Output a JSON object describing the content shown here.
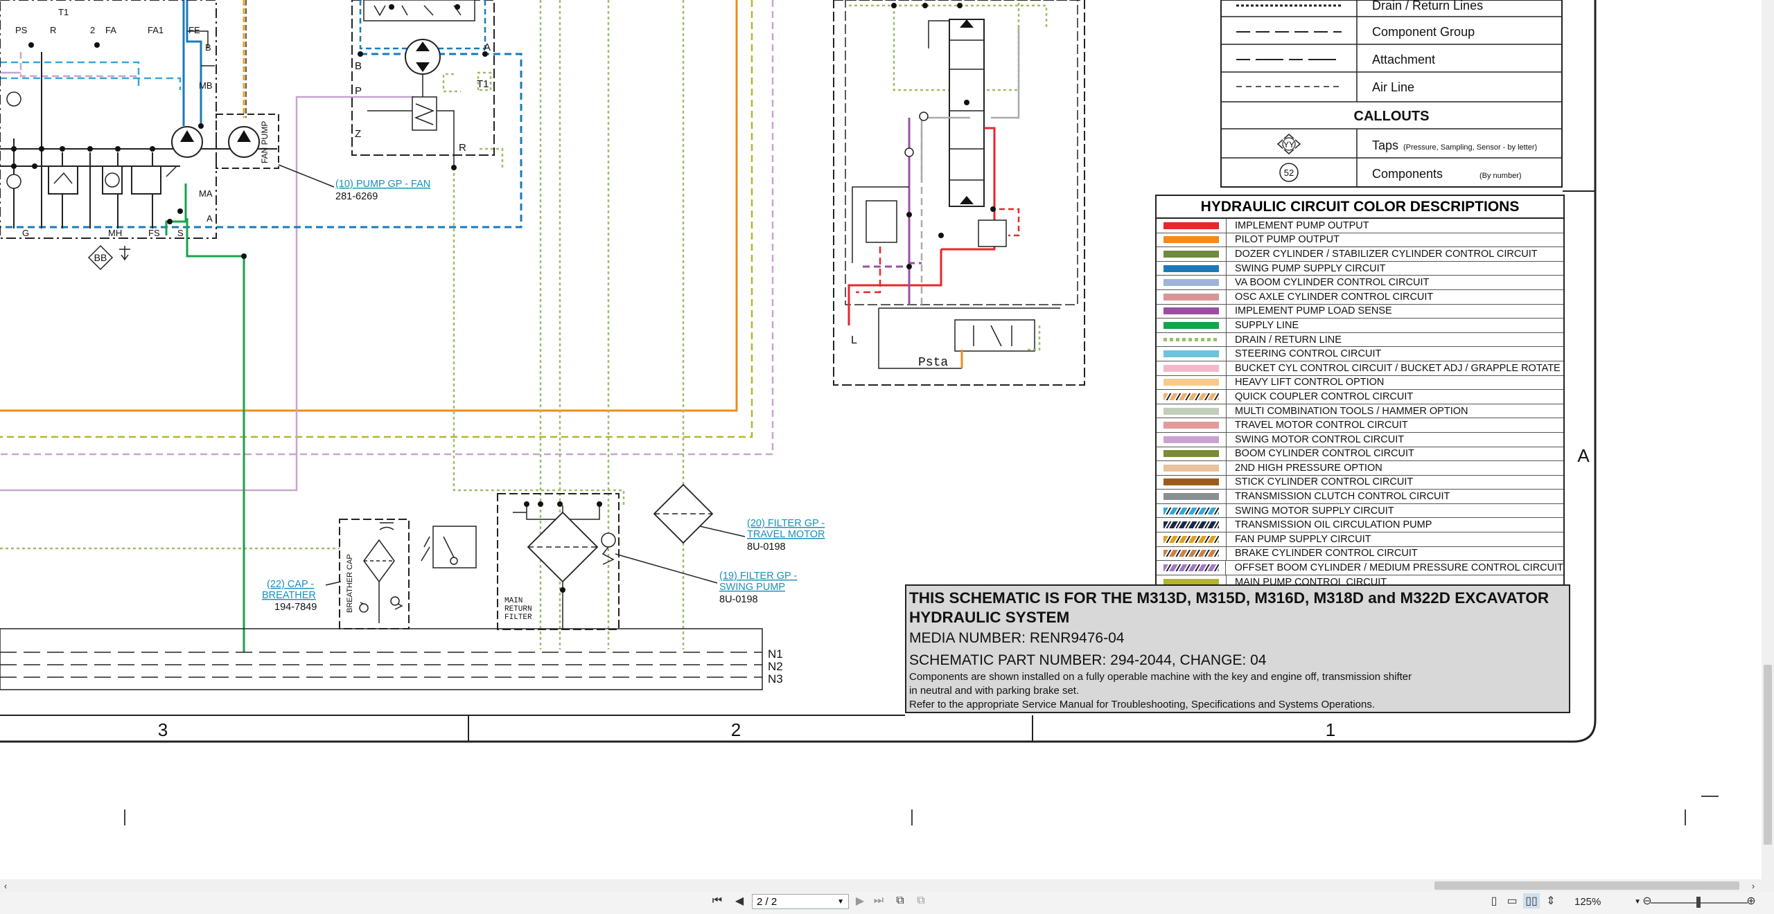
{
  "diagram": {
    "ports_left": [
      "PS",
      "R",
      "T1",
      "2",
      "FA",
      "FA1",
      "FE",
      "B",
      "MB",
      "MA",
      "A",
      "G",
      "MH",
      "FS",
      "S"
    ],
    "ports_mid": [
      "B",
      "P",
      "Z",
      "R",
      "T1",
      "A"
    ],
    "fan_pump_label": "FAN PUMP",
    "tap_bb": "BB",
    "callout_pump_fan": {
      "link": "(10) PUMP GP - FAN",
      "part": "281-6269"
    },
    "callout_cap_breather": {
      "link1": "(22) CAP -",
      "link2": "BREATHER",
      "part": "194-7849"
    },
    "breather_cap_label": "BREATHER CAP",
    "main_return_filter_label": [
      "MAIN",
      "RETURN",
      "FILTER"
    ],
    "callout_filter_travel": {
      "link1": "(20) FILTER GP -",
      "link2": "TRAVEL MOTOR",
      "part": "8U-0198"
    },
    "callout_filter_swing": {
      "link1": "(19) FILTER GP -",
      "link2": "SWING PUMP",
      "part": "8U-0198"
    },
    "valve_labels": [
      "L",
      "Psta"
    ],
    "tank_lines": [
      "N1",
      "N2",
      "N3"
    ],
    "zones": [
      "3",
      "2",
      "1"
    ],
    "row_marker": "A"
  },
  "line_key": {
    "rows": [
      {
        "label": "Drain / Return Lines",
        "style": "dotted"
      },
      {
        "label": "Component Group",
        "style": "dash"
      },
      {
        "label": "Attachment",
        "style": "dashdot"
      },
      {
        "label": "Air Line",
        "style": "shortdash"
      }
    ],
    "callouts_title": "CALLOUTS",
    "taps": {
      "symbol": "YY",
      "label": "Taps",
      "note": "(Pressure, Sampling, Sensor - by letter)"
    },
    "components": {
      "symbol": "52",
      "label": "Components",
      "note": "(By number)"
    }
  },
  "color_legend": {
    "title": "HYDRAULIC CIRCUIT COLOR DESCRIPTIONS",
    "items": [
      {
        "label": "IMPLEMENT PUMP OUTPUT",
        "color": "#e8262b",
        "pattern": "solid"
      },
      {
        "label": "PILOT PUMP OUTPUT",
        "color": "#f28a1c",
        "pattern": "solid"
      },
      {
        "label": "DOZER CYLINDER / STABILIZER CYLINDER CONTROL CIRCUIT",
        "color": "#6e8a3c",
        "pattern": "solid"
      },
      {
        "label": "SWING PUMP SUPPLY CIRCUIT",
        "color": "#1a7ab8",
        "pattern": "solid"
      },
      {
        "label": "VA BOOM CYLINDER CONTROL CIRCUIT",
        "color": "#9db4d6",
        "pattern": "solid"
      },
      {
        "label": "OSC AXLE CYLINDER CONTROL CIRCUIT",
        "color": "#d99595",
        "pattern": "solid"
      },
      {
        "label": "IMPLEMENT PUMP LOAD SENSE",
        "color": "#9a4fa0",
        "pattern": "solid"
      },
      {
        "label": "SUPPLY LINE",
        "color": "#16a34a",
        "pattern": "solid"
      },
      {
        "label": "DRAIN / RETURN LINE",
        "color": "#9bbf6a",
        "pattern": "dotted"
      },
      {
        "label": "STEERING CONTROL CIRCUIT",
        "color": "#6cc3dc",
        "pattern": "solid"
      },
      {
        "label": "BUCKET CYL CONTROL CIRCUIT / BUCKET ADJ / GRAPPLE ROTATE",
        "color": "#f2b8c9",
        "pattern": "solid"
      },
      {
        "label": "HEAVY LIFT CONTROL OPTION",
        "color": "#f8c98a",
        "pattern": "solid"
      },
      {
        "label": "QUICK COUPLER CONTROL CIRCUIT",
        "color": "#f0b070",
        "pattern": "hatch"
      },
      {
        "label": "MULTI COMBINATION TOOLS / HAMMER OPTION",
        "color": "#c3cdbb",
        "pattern": "solid"
      },
      {
        "label": "TRAVEL MOTOR CONTROL CIRCUIT",
        "color": "#e39a9a",
        "pattern": "solid"
      },
      {
        "label": "SWING MOTOR CONTROL CIRCUIT",
        "color": "#c9a3cf",
        "pattern": "solid"
      },
      {
        "label": "BOOM CYLINDER CONTROL CIRCUIT",
        "color": "#7a8a35",
        "pattern": "solid"
      },
      {
        "label": "2ND HIGH PRESSURE OPTION",
        "color": "#e8c29c",
        "pattern": "solid"
      },
      {
        "label": "STICK CYLINDER CONTROL CIRCUIT",
        "color": "#9b5a1a",
        "pattern": "solid"
      },
      {
        "label": "TRANSMISSION CLUTCH CONTROL CIRCUIT",
        "color": "#8a8f93",
        "pattern": "solid"
      },
      {
        "label": "SWING MOTOR SUPPLY CIRCUIT",
        "color": "#37a7d6",
        "pattern": "hatch"
      },
      {
        "label": "TRANSMISSION OIL CIRCULATION PUMP",
        "color": "#1b2a4a",
        "pattern": "hatch"
      },
      {
        "label": "FAN PUMP SUPPLY CIRCUIT",
        "color": "#e0a020",
        "pattern": "hatch"
      },
      {
        "label": "BRAKE CYLINDER CONTROL CIRCUIT",
        "color": "#c8844a",
        "pattern": "hatch"
      },
      {
        "label": "OFFSET BOOM CYLINDER / MEDIUM PRESSURE CONTROL CIRCUIT",
        "color": "#a07ac8",
        "pattern": "hatch"
      },
      {
        "label": "MAIN PUMP CONTROL CIRCUIT",
        "color": "#b5b52a",
        "pattern": "solid"
      }
    ]
  },
  "title_block": {
    "line1": "THIS SCHEMATIC IS FOR THE M313D, M315D, M316D, M318D and M322D EXCAVATOR",
    "line2": "HYDRAULIC SYSTEM",
    "media": "MEDIA NUMBER: RENR9476-04",
    "part": "SCHEMATIC PART NUMBER: 294-2044, CHANGE: 04",
    "note1": "Components are shown installed on a fully operable machine with the key and engine off, transmission shifter",
    "note2": "in neutral and with parking brake set.",
    "note3": "Refer to the appropriate Service Manual for Troubleshooting, Specifications and Systems Operations."
  },
  "viewer": {
    "page_field": "2 / 2",
    "zoom": "125%",
    "icons": [
      "first-page-icon",
      "prev-page-icon",
      "next-page-icon",
      "last-page-icon",
      "previous-view-icon",
      "next-view-icon",
      "single-page-icon",
      "continuous-icon",
      "two-page-icon",
      "fit-icon",
      "zoom-out-icon",
      "zoom-in-icon"
    ]
  }
}
